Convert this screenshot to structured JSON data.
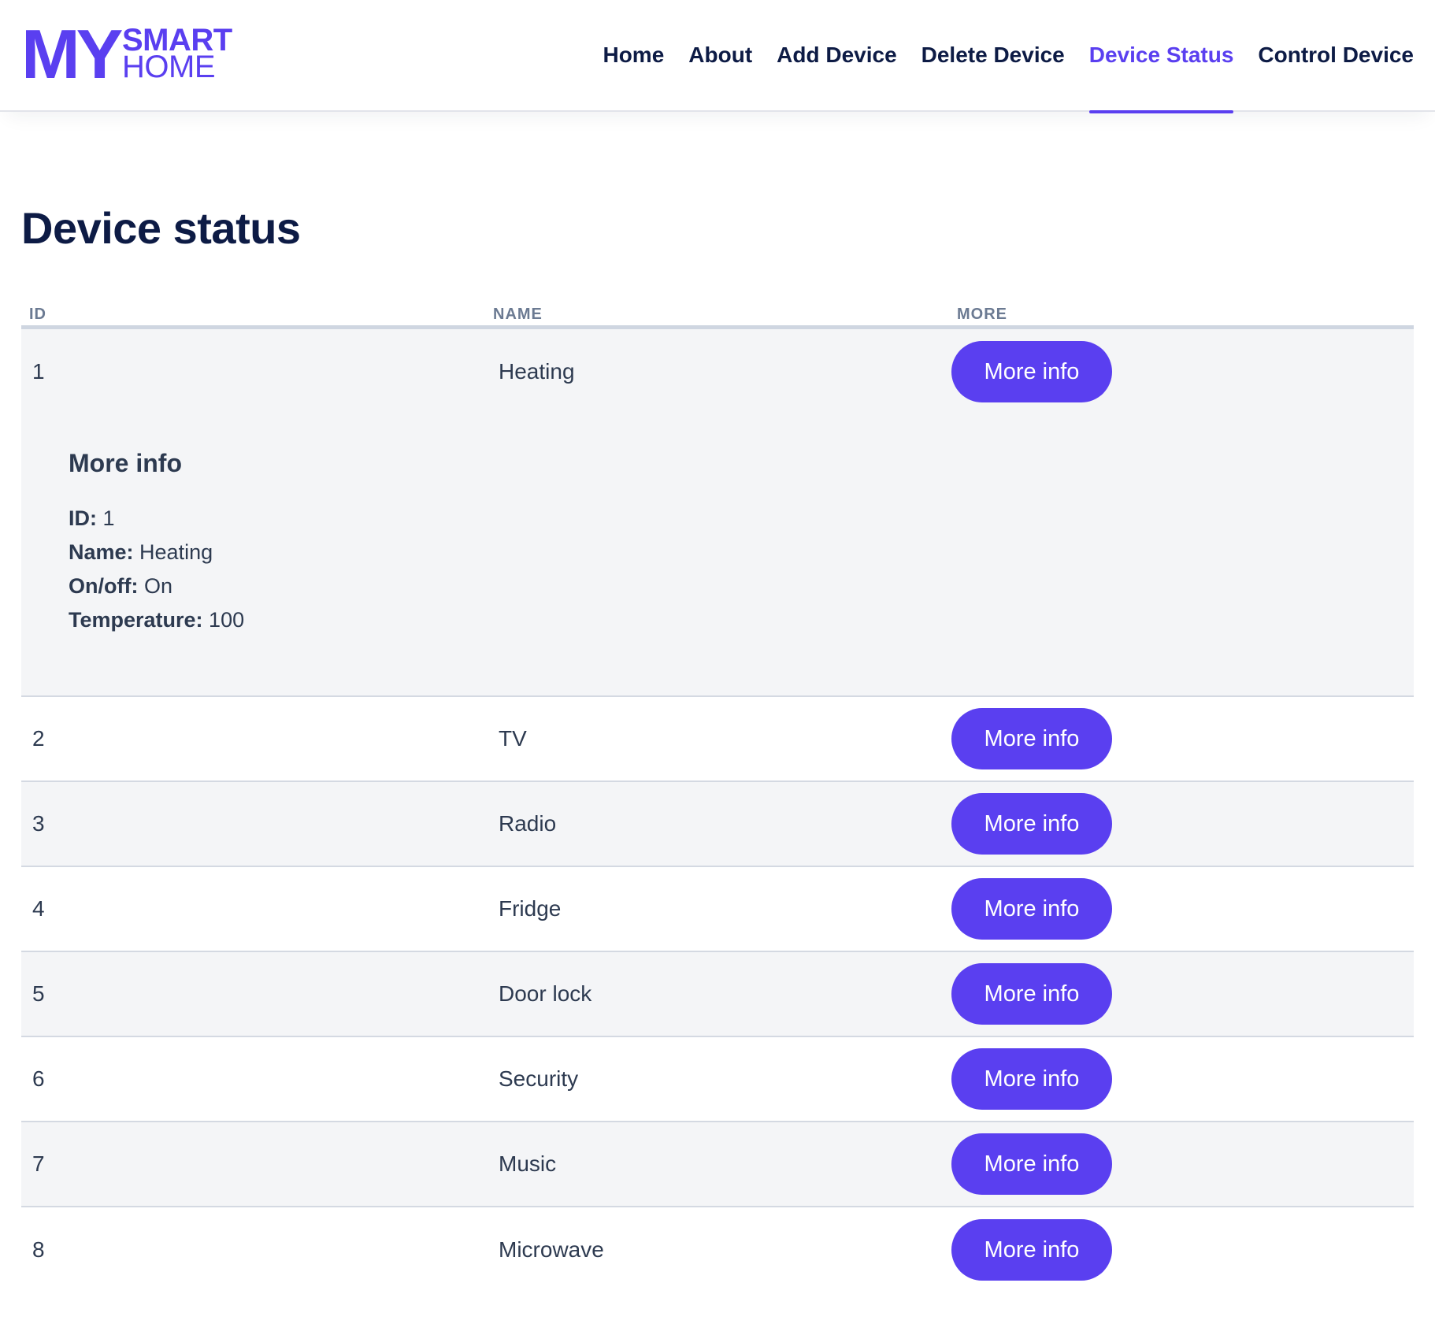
{
  "logo": {
    "my": "MY",
    "smart": "SMART",
    "home": "HOME"
  },
  "nav": {
    "items": [
      {
        "label": "Home",
        "active": false
      },
      {
        "label": "About",
        "active": false
      },
      {
        "label": "Add Device",
        "active": false
      },
      {
        "label": "Delete Device",
        "active": false
      },
      {
        "label": "Device Status",
        "active": true
      },
      {
        "label": "Control Device",
        "active": false
      }
    ]
  },
  "page": {
    "title": "Device status"
  },
  "table": {
    "headers": {
      "id": "ID",
      "name": "NAME",
      "more": "MORE"
    },
    "button_label": "More info",
    "rows": [
      {
        "id": "1",
        "name": "Heating"
      },
      {
        "id": "2",
        "name": "TV"
      },
      {
        "id": "3",
        "name": "Radio"
      },
      {
        "id": "4",
        "name": "Fridge"
      },
      {
        "id": "5",
        "name": "Door lock"
      },
      {
        "id": "6",
        "name": "Security"
      },
      {
        "id": "7",
        "name": "Music"
      },
      {
        "id": "8",
        "name": "Microwave"
      }
    ],
    "details": {
      "title": "More info",
      "fields": [
        {
          "key": "ID:",
          "value": " 1"
        },
        {
          "key": "Name:",
          "value": " Heating"
        },
        {
          "key": "On/off:",
          "value": " On"
        },
        {
          "key": "Temperature:",
          "value": " 100"
        }
      ]
    }
  },
  "colors": {
    "accent": "#5a3ff0",
    "heading": "#0d1b45",
    "row_alt": "#f4f5f7"
  }
}
